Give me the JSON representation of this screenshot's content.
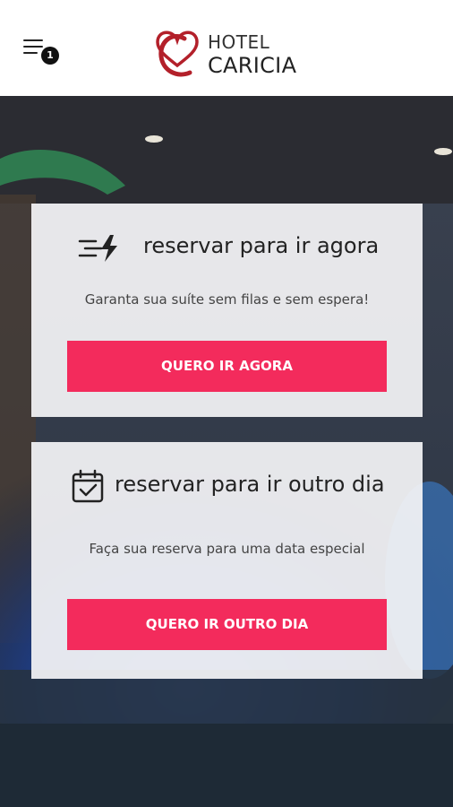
{
  "header": {
    "menu_icon": "hamburger-menu-icon",
    "badge_count": "1",
    "logo": {
      "line1": "HOTEL",
      "line2": "CARICIA",
      "brand_color": "#b3202a"
    }
  },
  "cards": [
    {
      "icon": "fast-lightning-icon",
      "title": "reservar para ir agora",
      "subtitle": "Garanta sua suíte sem filas e sem espera!",
      "button_label": "QUERO IR AGORA"
    },
    {
      "icon": "calendar-check-icon",
      "title": "reservar para ir outro dia",
      "subtitle": "Faça sua reserva para uma data especial",
      "button_label": "QUERO IR OUTRO DIA"
    }
  ],
  "colors": {
    "accent": "#f32b5c",
    "header_bg": "#ffffff",
    "card_bg": "#f4f4f6"
  }
}
